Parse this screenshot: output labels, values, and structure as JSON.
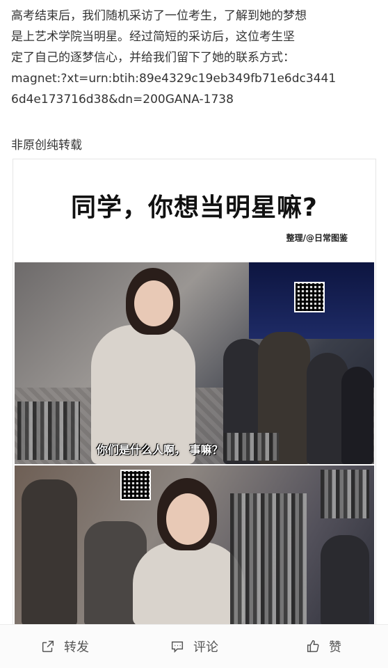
{
  "post": {
    "text_lines": [
      "高考结束后，我们随机采访了一位考生，了解到她的梦想",
      "是上艺术学院当明星。经过简短的采访后，这位考生坚",
      "定了自己的逐梦信心，并给我们留下了她的联系方式：",
      "magnet:?xt=urn:btih:89e4329c19eb349fb71e6dc3441",
      "6d4e173716d38&dn=200GANA-1738"
    ],
    "source_note": "非原创纯转载"
  },
  "image": {
    "headline": "同学，你想当明星嘛?",
    "credit": "整理/@日常图鉴",
    "subtitle": "你们是什么人啊， 事嘛？"
  },
  "actions": {
    "share_label": "转发",
    "comment_label": "评论",
    "like_label": "赞",
    "share_icon": "share-icon",
    "comment_icon": "comment-icon",
    "like_icon": "thumbs-up-icon"
  }
}
